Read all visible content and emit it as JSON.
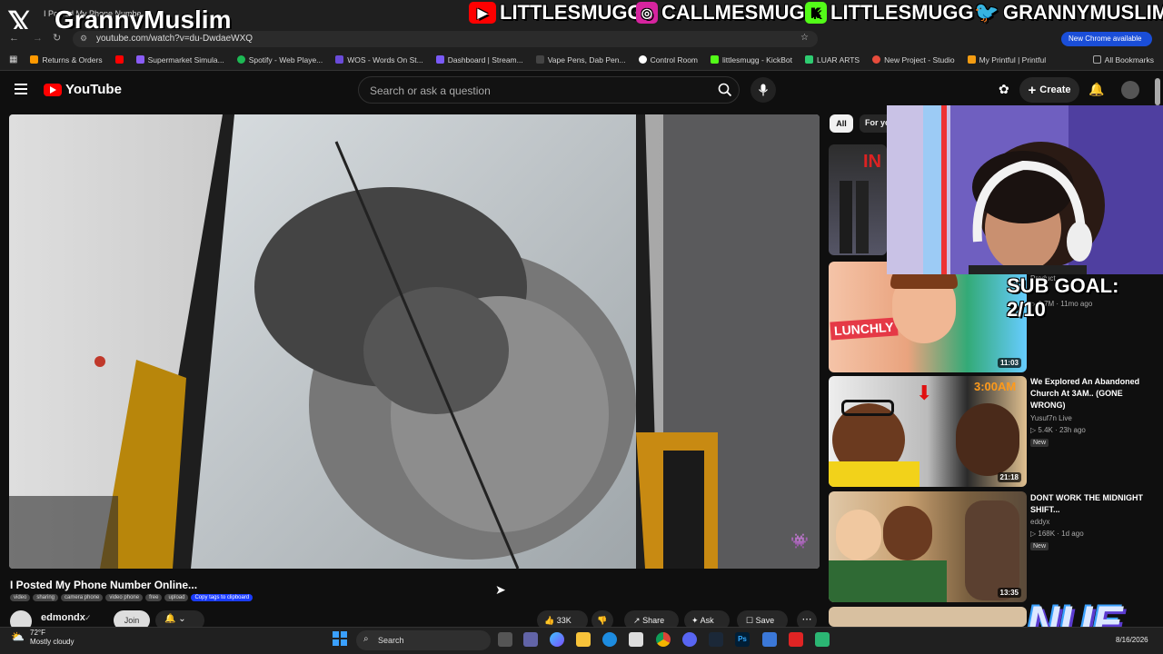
{
  "browser": {
    "tab_title": "I Posted My Phone Numbe",
    "url": "youtube.com/watch?v=du-DwdaeWXQ",
    "new_chrome_label": "New Chrome available",
    "bookmarks": [
      {
        "label": "Returns & Orders",
        "color": "#ff9900"
      },
      {
        "label": "",
        "color": "#ff0000"
      },
      {
        "label": "Supermarket Simula...",
        "color": "#8a5cf6"
      },
      {
        "label": "Spotify - Web Playe...",
        "color": "#1db954"
      },
      {
        "label": "WOS - Words On St...",
        "color": "#6a4bd9"
      },
      {
        "label": "Dashboard | Stream...",
        "color": "#7a5af8"
      },
      {
        "label": "Vape Pens, Dab Pen...",
        "color": "#444"
      },
      {
        "label": "Control Room",
        "color": "#ffffff"
      },
      {
        "label": "littlesmugg - KickBot",
        "color": "#53fc18"
      },
      {
        "label": "LUAR ARTS",
        "color": "#2ecc71"
      },
      {
        "label": "New Project - Studio",
        "color": "#e74c3c"
      },
      {
        "label": "My Printful | Printful",
        "color": "#f39c12"
      }
    ],
    "all_bookmarks": "All Bookmarks"
  },
  "overlay": {
    "x_name": "GrannyMuslim",
    "socials": [
      {
        "platform": "youtube",
        "handle": "LITTLESMUGG",
        "color": "#ff0000"
      },
      {
        "platform": "instagram",
        "handle": "CALLMESMUGG",
        "color": "#d6249f"
      },
      {
        "platform": "kick",
        "handle": "LITTLESMUGG",
        "color": "#53fc18"
      },
      {
        "platform": "twitter",
        "handle": "GRANNYMUSLIM",
        "color": "#1da1f2"
      }
    ],
    "sub_goal": "SUB GOAL: 2/10",
    "nue_logo": "NUE"
  },
  "youtube": {
    "logo_text": "YouTube",
    "search_placeholder": "Search or ask a question",
    "create_label": "Create",
    "video_title": "I Posted My Phone Number Online...",
    "tags": [
      "video",
      "sharing",
      "camera phone",
      "video phone",
      "free",
      "upload"
    ],
    "copy_tags": "Copy tags to clipboard",
    "channel": "edmondx",
    "join_label": "Join",
    "like_count": "33K",
    "share_label": "Share",
    "ask_label": "Ask",
    "save_label": "Save",
    "chips": {
      "all": "All",
      "for_you": "For you"
    },
    "recommendations": [
      {
        "title": "",
        "channel": "",
        "meta": "",
        "duration": "",
        "new": false
      },
      {
        "title": "",
        "channel": "Product",
        "meta": "2.7M · 11mo ago",
        "duration": "11:03",
        "new": false
      },
      {
        "title": "We Explored An Abandoned Church At 3AM.. (GONE WRONG)",
        "channel": "Yusuf7n Live",
        "meta": "5.4K · 23h ago",
        "duration": "21:18",
        "new": true
      },
      {
        "title": "DONT WORK THE MIDNIGHT SHIFT...",
        "channel": "eddyx",
        "meta": "168K · 1d ago",
        "duration": "13:35",
        "new": true
      }
    ]
  },
  "taskbar": {
    "temp": "72°F",
    "condition": "Mostly cloudy",
    "search_label": "Search",
    "date": "8/16/2026"
  }
}
